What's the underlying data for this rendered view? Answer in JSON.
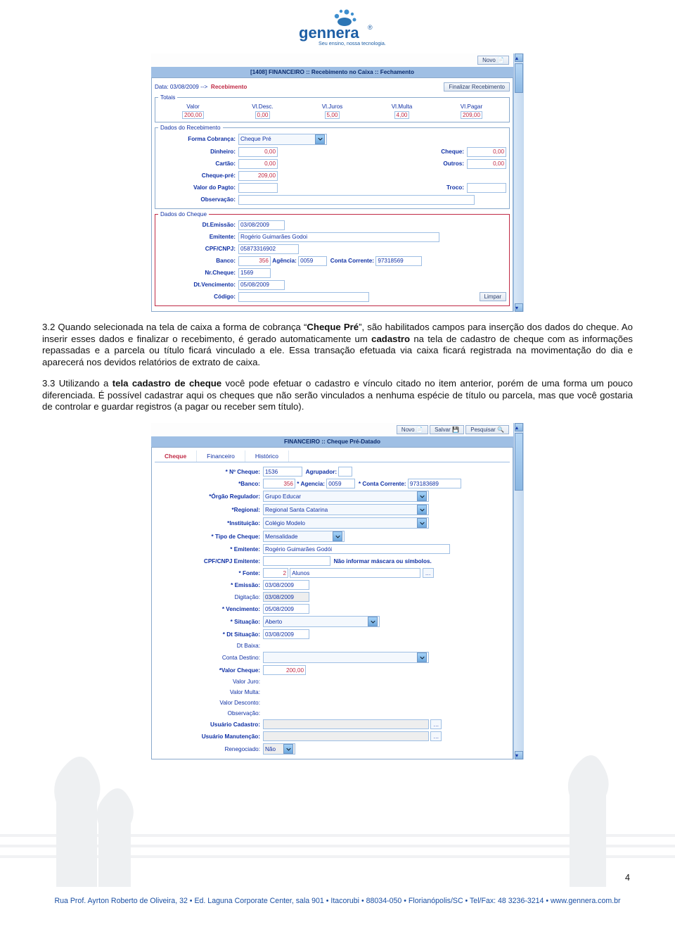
{
  "logo": {
    "brand": "gennera",
    "tagline": "Seu ensino, nossa tecnologia.",
    "reg": "®"
  },
  "shot1": {
    "novo_btn": "Novo",
    "title": "[1408] FINANCEIRO :: Recebimento no Caixa :: Fechamento",
    "data_label": "Data: 03/08/2009  -->",
    "recebimento_link": "Recebimento",
    "finalizar_btn": "Finalizar Recebimento",
    "totais_legend": "Totais",
    "th_valor": "Valor",
    "th_desc": "Vl.Desc.",
    "th_juros": "Vl.Juros",
    "th_multa": "Vl.Multa",
    "th_pagar": "Vl.Pagar",
    "v_valor": "200,00",
    "v_desc": "0,00",
    "v_juros": "5,00",
    "v_multa": "4,00",
    "v_pagar": "209,00",
    "dados_receb_legend": "Dados do Recebimento",
    "forma_cobr_label": "Forma Cobrança:",
    "forma_cobr_val": "Cheque Pré",
    "dinheiro_label": "Dinheiro:",
    "dinheiro_val": "0,00",
    "cheque_label": "Cheque:",
    "cheque_val": "0,00",
    "cartao_label": "Cartão:",
    "cartao_val": "0,00",
    "outros_label": "Outros:",
    "outros_val": "0,00",
    "chequepre_label": "Cheque-pré:",
    "chequepre_val": "209,00",
    "valorpagto_label": "Valor do Pagto:",
    "valorpagto_val": "",
    "troco_label": "Troco:",
    "troco_val": "",
    "obs_label": "Observação:",
    "dados_cheque_legend": "Dados do Cheque",
    "dt_emissao_label": "Dt.Emissão:",
    "dt_emissao_val": "03/08/2009",
    "emitente_label": "Emitente:",
    "emitente_val": "Rogério Guimarães Godoi",
    "cpf_label": "CPF/CNPJ:",
    "cpf_val": "05873316902",
    "banco_label": "Banco:",
    "banco_val": "356",
    "agencia_label": "Agência:",
    "agencia_val": "0059",
    "cc_label": "Conta Corrente:",
    "cc_val": "97318569",
    "nrcheque_label": "Nr.Cheque:",
    "nrcheque_val": "1569",
    "dtvenc_label": "Dt.Vencimento:",
    "dtvenc_val": "05/08/2009",
    "codigo_label": "Código:",
    "limpar_btn": "Limpar"
  },
  "para32": "3.2 Quando selecionada na tela de caixa a forma de cobrança “Cheque Pré”, são habilitados campos para inserção dos dados do cheque. Ao inserir esses dados e finalizar o recebimento, é gerado automaticamente um cadastro na tela de cadastro de cheque com as informações repassadas e a parcela ou título ficará vinculado a ele. Essa transação efetuada via caixa ficará registrada na movimentação do dia e aparecerá nos devidos relatórios de extrato de caixa.",
  "para32_bold1": "Cheque Pré",
  "para32_bold2": "cadastro",
  "para33": "3.3 Utilizando a tela cadastro de cheque você pode efetuar o cadastro e vínculo citado no item anterior, porém de uma forma um pouco diferenciada. É possível cadastrar aqui os cheques que não serão vinculados a nenhuma espécie de título ou parcela, mas que você gostaria de controlar e guardar registros (a pagar ou receber sem título).",
  "para33_bold": "tela cadastro de cheque",
  "shot2": {
    "novo_btn": "Novo",
    "salvar_btn": "Salvar",
    "pesquisar_btn": "Pesquisar",
    "title": "FINANCEIRO :: Cheque Pré-Datado",
    "tab_cheque": "Cheque",
    "tab_financeiro": "Financeiro",
    "tab_historico": "Histórico",
    "ncheque_label": "* Nº Cheque:",
    "ncheque_val": "1536",
    "agrupador_label": "Agrupador:",
    "banco_label": "*Banco:",
    "banco_val": "356",
    "agencia_label": "* Agencia:",
    "agencia_val": "0059",
    "cc_label": "* Conta Corrente:",
    "cc_val": "973183689",
    "orgao_label": "*Órgão Regulador:",
    "orgao_val": "Grupo Educar",
    "regional_label": "*Regional:",
    "regional_val": "Regional Santa Catarina",
    "inst_label": "*Instituição:",
    "inst_val": "Colégio Modelo",
    "tipo_label": "* Tipo de Cheque:",
    "tipo_val": "Mensalidade",
    "emitente_label": "* Emitente:",
    "emitente_val": "Rogério Guimarães Godói",
    "cpfemit_label": "CPF/CNPJ Emitente:",
    "cpf_hint": "Não informar máscara ou símbolos.",
    "fonte_label": "* Fonte:",
    "fonte_val": "2",
    "fonte_txt": "Alunos",
    "emissao_label": "* Emissão:",
    "emissao_val": "03/08/2009",
    "digitacao_label": "Digitação:",
    "digitacao_val": "03/08/2009",
    "venc_label": "* Vencimento:",
    "venc_val": "05/08/2009",
    "sit_label": "* Situação:",
    "sit_val": "Aberto",
    "dtsit_label": "* Dt Situação:",
    "dtsit_val": "03/08/2009",
    "dtbaixa_label": "Dt Baixa:",
    "contadest_label": "Conta Destino:",
    "valorcheque_label": "*Valor Cheque:",
    "valorcheque_val": "200,00",
    "valorjuro_label": "Valor Juro:",
    "valormulta_label": "Valor Multa:",
    "valordesc_label": "Valor Desconto:",
    "obs_label": "Observação:",
    "usucad_label": "Usuário Cadastro:",
    "usuman_label": "Usuário Manutenção:",
    "reneg_label": "Renegociado:",
    "reneg_val": "Não"
  },
  "page_number": "4",
  "footer": "Rua Prof. Ayrton Roberto de Oliveira, 32 • Ed. Laguna Corporate Center, sala 901 • Itacorubi • 88034-050 • Florianópolis/SC • Tel/Fax: 48 3236-3214 • www.gennera.com.br"
}
